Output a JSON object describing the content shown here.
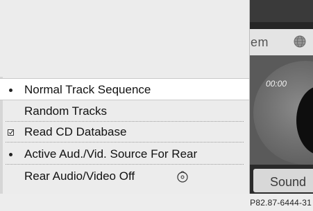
{
  "background": {
    "tab_label": "em",
    "elapsed_time": "00:00",
    "sound_button_label": "Sound"
  },
  "menu": {
    "items": [
      {
        "label": "Normal Track Sequence",
        "marker": "bullet",
        "highlighted": true
      },
      {
        "label": "Random Tracks",
        "marker": "none",
        "highlighted": false
      },
      {
        "label": "Read CD Database",
        "marker": "checkbox-checked",
        "highlighted": false
      },
      {
        "label": "Active Aud./Vid. Source For Rear",
        "marker": "bullet",
        "highlighted": false
      },
      {
        "label": "Rear Audio/Video Off",
        "marker": "none",
        "trailing_icon": "cd-icon",
        "highlighted": false
      }
    ]
  },
  "figure_id": "P82.87-6444-31",
  "colors": {
    "menu_background": "#ececec",
    "highlight_row": "#ffffff",
    "screen_dark": "#262626"
  }
}
